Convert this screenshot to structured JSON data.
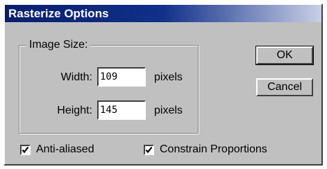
{
  "dialog": {
    "title": "Rasterize Options",
    "image_size_label": "Image Size:",
    "width_label": "Width:",
    "width_value": "109",
    "width_unit": "pixels",
    "height_label": "Height:",
    "height_value": "145",
    "height_unit": "pixels",
    "ok_label": "OK",
    "cancel_label": "Cancel",
    "anti_aliased_label": "Anti-aliased",
    "anti_aliased_checked": true,
    "constrain_label": "Constrain Proportions",
    "constrain_checked": true
  }
}
